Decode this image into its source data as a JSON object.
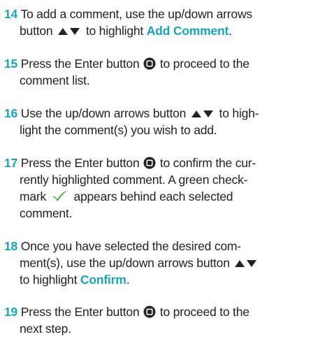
{
  "steps": [
    {
      "number": "14",
      "line1_a": "To add a comment, use the up/down arrows",
      "line2_a": "button",
      "line2_b": "to highlight",
      "line2_highlight": "Add Comment",
      "line2_c": "."
    },
    {
      "number": "15",
      "line1_a": "Press the Enter button",
      "line1_b": "to proceed to the",
      "line2_a": "comment list."
    },
    {
      "number": "16",
      "line1_a": "Use the up/down arrows button",
      "line1_b": "to high-",
      "line2_a": "light the comment(s) you wish to add."
    },
    {
      "number": "17",
      "line1_a": "Press the Enter button",
      "line1_b": "to confirm the cur-",
      "line2_a": "rently highlighted comment. A green check-",
      "line3_a": "mark",
      "line3_b": "appears behind each selected",
      "line4_a": "comment."
    },
    {
      "number": "18",
      "line1_a": "Once you have selected the desired com-",
      "line2_a": "ment(s), use the up/down arrows button",
      "line3_a": "to highlight",
      "line3_highlight": "Confirm",
      "line3_c": "."
    },
    {
      "number": "19",
      "line1_a": "Press the Enter button",
      "line1_b": "to proceed to the",
      "line2_a": "next step."
    }
  ],
  "icons": {
    "up_down_arrows": "up-down-arrows-icon",
    "enter_button": "enter-button-icon",
    "checkmark": "green-checkmark-icon"
  },
  "colors": {
    "accent": "#1aa3b8",
    "text": "#222222",
    "checkmark": "#3aa935"
  }
}
